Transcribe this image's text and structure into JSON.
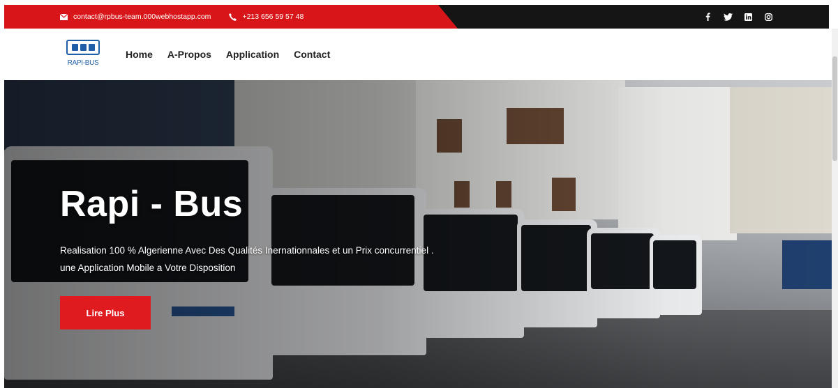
{
  "topbar": {
    "email": "contact@rpbus-team.000webhostapp.com",
    "phone": "+213 656 59 57 48",
    "email_icon": "envelope-icon",
    "phone_icon": "phone-icon",
    "social": [
      {
        "icon": "facebook-icon",
        "glyph": "f"
      },
      {
        "icon": "twitter-icon",
        "glyph": "t"
      },
      {
        "icon": "linkedin-icon",
        "glyph": "in"
      },
      {
        "icon": "instagram-icon",
        "glyph": "ig"
      }
    ],
    "red_color": "#d8161a",
    "dark_color": "#151515"
  },
  "navbar": {
    "logo_text": "RAPI-BUS",
    "menu": [
      "Home",
      "A-Propos",
      "Application",
      "Contact"
    ]
  },
  "hero": {
    "title": "Rapi - Bus",
    "description": "Realisation 100 % Algerienne Avec Des Qualités Inernationnales et un Prix concurrentiel . une Application Mobile a Votre Disposition",
    "button_label": "Lire Plus",
    "button_color": "#e01b1f"
  }
}
